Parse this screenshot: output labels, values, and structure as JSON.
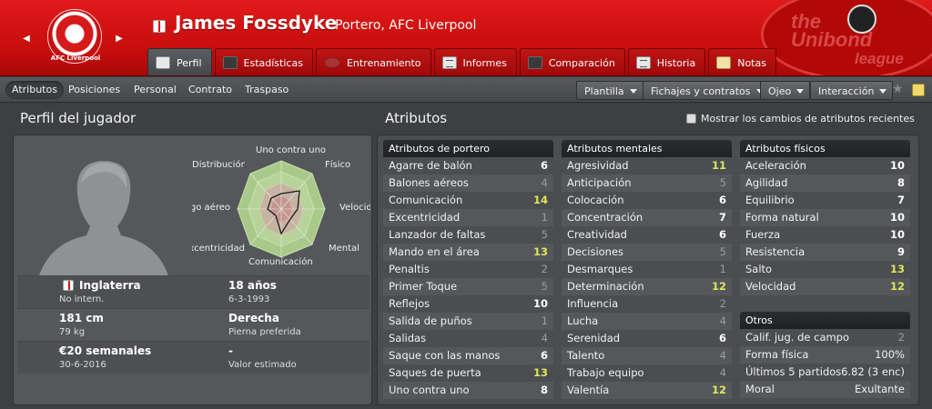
{
  "header": {
    "club_short": "AFC Liverpool",
    "player_name": "James Fossdyke",
    "player_role": "Portero, AFC Liverpool",
    "league_logo": {
      "line1": "the",
      "line2": "Unibond",
      "line3": "league"
    }
  },
  "tabs": [
    {
      "label": "Perfil",
      "icon": "profile-card-icon"
    },
    {
      "label": "Estadísticas",
      "icon": "stats-icon"
    },
    {
      "label": "Entrenamiento",
      "icon": "training-ball-icon"
    },
    {
      "label": "Informes",
      "icon": "report-icon"
    },
    {
      "label": "Comparación",
      "icon": "compare-icon"
    },
    {
      "label": "Historia",
      "icon": "history-icon"
    },
    {
      "label": "Notas",
      "icon": "notes-icon"
    }
  ],
  "subtabs": [
    "Atributos",
    "Posiciones",
    "Personal",
    "Contrato",
    "Traspaso"
  ],
  "dropdowns": [
    "Plantilla",
    "Fichajes y contratos",
    "Ojeo",
    "Interacción"
  ],
  "profile": {
    "title": "Perfil del jugador",
    "radar_labels": {
      "top": "Uno contra uno",
      "top_left": "Distribución",
      "top_right": "Físico",
      "left": "Juego aéreo",
      "right": "Velocidad",
      "bottom_left": "Excentricidad",
      "bottom_right": "Mental",
      "bottom": "Comunicación"
    },
    "nationality": "Inglaterra",
    "caps": "No intern.",
    "age": "18 años",
    "dob": "6-3-1993",
    "height": "181 cm",
    "weight": "79 kg",
    "foot": "Derecha",
    "foot_label": "Pierna preferida",
    "wage": "€20 semanales",
    "contract_end": "30-6-2016",
    "value": "-",
    "value_label": "Valor estimado"
  },
  "attributes": {
    "title": "Atributos",
    "toggle_label": "Mostrar los cambios de atributos recientes",
    "goalkeeping": {
      "header": "Atributos de portero",
      "rows": [
        [
          "Agarre de balón",
          "6"
        ],
        [
          "Balones aéreos",
          "4"
        ],
        [
          "Comunicación",
          "14"
        ],
        [
          "Excentricidad",
          "1"
        ],
        [
          "Lanzador de faltas",
          "5"
        ],
        [
          "Mando en el área",
          "13"
        ],
        [
          "Penaltis",
          "2"
        ],
        [
          "Primer Toque",
          "5"
        ],
        [
          "Reflejos",
          "10"
        ],
        [
          "Salida de puños",
          "1"
        ],
        [
          "Salidas",
          "4"
        ],
        [
          "Saque con las manos",
          "6"
        ],
        [
          "Saques de puerta",
          "13"
        ],
        [
          "Uno contra uno",
          "8"
        ]
      ]
    },
    "mental": {
      "header": "Atributos mentales",
      "rows": [
        [
          "Agresividad",
          "11"
        ],
        [
          "Anticipación",
          "5"
        ],
        [
          "Colocación",
          "6"
        ],
        [
          "Concentración",
          "7"
        ],
        [
          "Creatividad",
          "6"
        ],
        [
          "Decisiones",
          "5"
        ],
        [
          "Desmarques",
          "1"
        ],
        [
          "Determinación",
          "12"
        ],
        [
          "Influencia",
          "2"
        ],
        [
          "Lucha",
          "4"
        ],
        [
          "Serenidad",
          "6"
        ],
        [
          "Talento",
          "4"
        ],
        [
          "Trabajo equipo",
          "4"
        ],
        [
          "Valentía",
          "12"
        ]
      ]
    },
    "physical": {
      "header": "Atributos físicos",
      "rows": [
        [
          "Aceleración",
          "10"
        ],
        [
          "Agilidad",
          "8"
        ],
        [
          "Equilibrio",
          "7"
        ],
        [
          "Forma natural",
          "10"
        ],
        [
          "Fuerza",
          "10"
        ],
        [
          "Resistencia",
          "9"
        ],
        [
          "Salto",
          "13"
        ],
        [
          "Velocidad",
          "12"
        ]
      ]
    },
    "other": {
      "header": "Otros",
      "rows": [
        [
          "Calif. jug. de campo",
          "2"
        ],
        [
          "Forma física",
          "100%"
        ],
        [
          "Últimos 5 partidos",
          "6.82 (3 enc)"
        ],
        [
          "Moral",
          "Exultante"
        ]
      ]
    }
  }
}
